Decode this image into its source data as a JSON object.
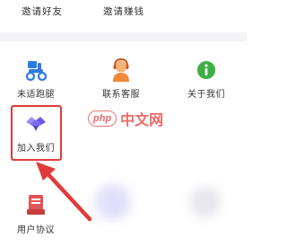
{
  "top_row": {
    "invite_friends": "邀请好友",
    "invite_earn": "邀请赚钱"
  },
  "grid": [
    {
      "label": "未适跑腿",
      "icon": "scooter-icon"
    },
    {
      "label": "联系客服",
      "icon": "customer-service-icon"
    },
    {
      "label": "关于我们",
      "icon": "info-icon"
    },
    {
      "label": "加入我们",
      "icon": "handshake-icon"
    },
    {
      "label": "用户协议",
      "icon": "document-icon"
    }
  ],
  "watermark": {
    "badge": "php",
    "text": "中文网"
  },
  "colors": {
    "highlight": "#e23a3a",
    "arrow": "#e23a3a",
    "info_green": "#3cb043",
    "scooter_blue": "#2c7be5",
    "handshake_purple": "#7b6cf0",
    "doc_red": "#e05555"
  }
}
